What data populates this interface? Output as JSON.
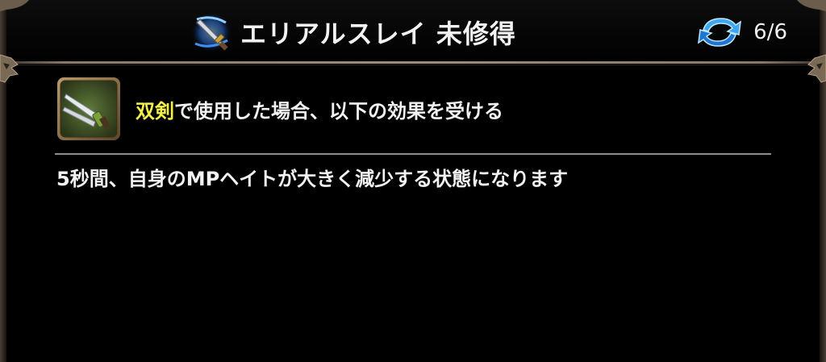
{
  "header": {
    "skill_name": "エリアルスレイ 未修得",
    "counter": "6/6",
    "skill_icon": "crossed-sword-icon",
    "counter_icon": "refresh-icon"
  },
  "effect": {
    "weapon_icon": "dual-swords-icon",
    "weapon_name": "双剣",
    "text": "で使用した場合、以下の効果を受ける"
  },
  "description": "5秒間、自身のMPヘイトが大きく減少する状態になります",
  "colors": {
    "background": "#000000",
    "weapon_highlight": "#f3ef4a",
    "text": "#f2f2f2",
    "frame": "#8a7a64"
  }
}
